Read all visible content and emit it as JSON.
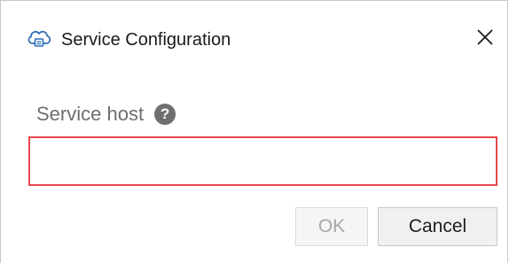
{
  "window": {
    "title": "Service Configuration",
    "app_icon": "cloud-icon",
    "close_icon": "close-icon"
  },
  "form": {
    "label": "Service host",
    "help_icon": "help-icon",
    "help_glyph": "?",
    "input_value": "",
    "input_state": "invalid",
    "error_border_color": "#e5474d"
  },
  "buttons": {
    "ok_label": "OK",
    "ok_state": "disabled",
    "cancel_label": "Cancel"
  }
}
